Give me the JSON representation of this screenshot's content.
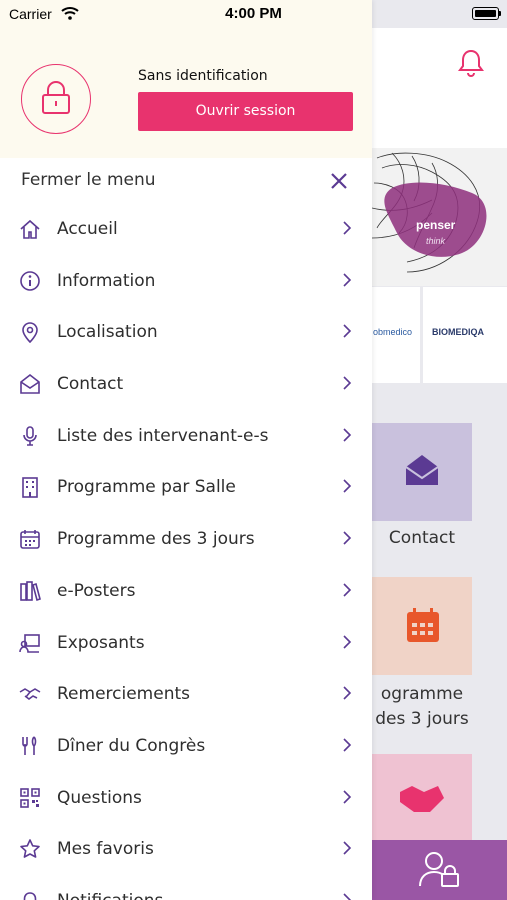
{
  "status_bar": {
    "carrier": "Carrier",
    "time": "4:00 PM"
  },
  "drawer": {
    "user_status": "Sans identification",
    "login_button": "Ouvrir session",
    "close_label": "Fermer le menu",
    "items": [
      {
        "label": "Accueil",
        "icon": "home-icon"
      },
      {
        "label": "Information",
        "icon": "info-icon"
      },
      {
        "label": "Localisation",
        "icon": "location-pin-icon"
      },
      {
        "label": "Contact",
        "icon": "envelope-open-icon"
      },
      {
        "label": "Liste des intervenant-e-s",
        "icon": "microphone-icon"
      },
      {
        "label": "Programme par Salle",
        "icon": "building-icon"
      },
      {
        "label": "Programme des 3 jours",
        "icon": "calendar-icon"
      },
      {
        "label": "e-Posters",
        "icon": "books-icon"
      },
      {
        "label": "Exposants",
        "icon": "presenter-icon"
      },
      {
        "label": "Remerciements",
        "icon": "handshake-icon"
      },
      {
        "label": "Dîner du Congrès",
        "icon": "utensils-icon"
      },
      {
        "label": "Questions",
        "icon": "qr-code-icon"
      },
      {
        "label": "Mes favoris",
        "icon": "star-icon"
      },
      {
        "label": "Notifications",
        "icon": "bell-icon"
      }
    ]
  },
  "background": {
    "hero_word": "penser",
    "hero_word_2": "think",
    "sponsor_1": "obmedico",
    "sponsor_2": "BIOMEDIQA",
    "tile_contact": "Contact",
    "tile_programme": "ogramme des 3 jours"
  },
  "colors": {
    "accent_pink": "#e8336e",
    "menu_icon_purple": "#5b3a93",
    "bottom_bar": "#9a56a5"
  }
}
